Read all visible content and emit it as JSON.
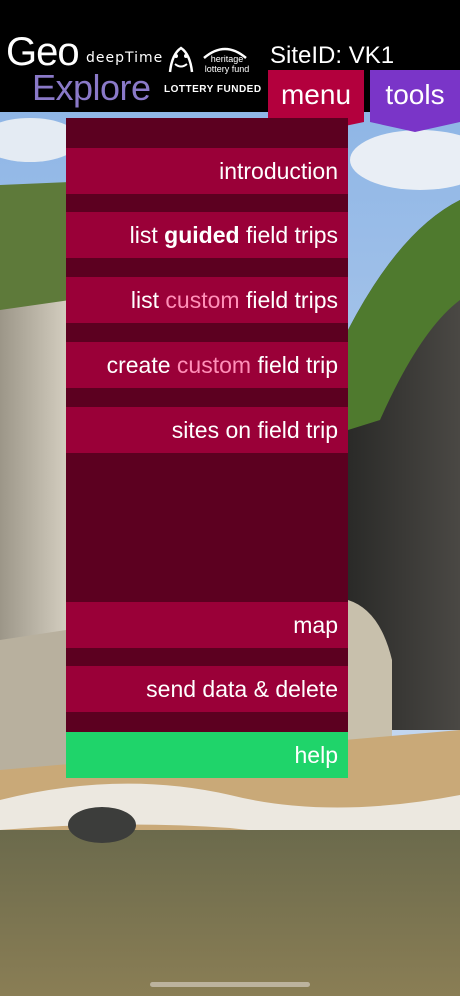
{
  "status_bar": {
    "time": ""
  },
  "header": {
    "logo_geo": "Geo",
    "logo_explore": "Explore",
    "logo_deeptime": "deepTime",
    "heritage_line1": "heritage",
    "heritage_line2": "lottery fund",
    "lottery_funded": "LOTTERY FUNDED",
    "site_id": "SiteID: VK1"
  },
  "tabs": {
    "menu": "menu",
    "tools": "tools"
  },
  "menu": {
    "introduction": "introduction",
    "list_guided": {
      "pre": "list ",
      "hl": "guided",
      "post": " field trips"
    },
    "list_custom": {
      "pre": "list ",
      "hl": "custom",
      "post": " field trips"
    },
    "create_custom": {
      "pre": "create ",
      "hl": "custom",
      "post": " field trip"
    },
    "sites_on_trip": "sites on field trip",
    "map": "map",
    "send_data": "send data & delete",
    "help": "help"
  },
  "colors": {
    "menu_bg": "#5c0020",
    "menu_item": "#9a0038",
    "highlight_pink": "#ff8fb8",
    "help_green": "#1fd46a",
    "tab_menu": "#b3003d",
    "tab_tools": "#7a35c8",
    "explore_purple": "#8a79c8"
  }
}
